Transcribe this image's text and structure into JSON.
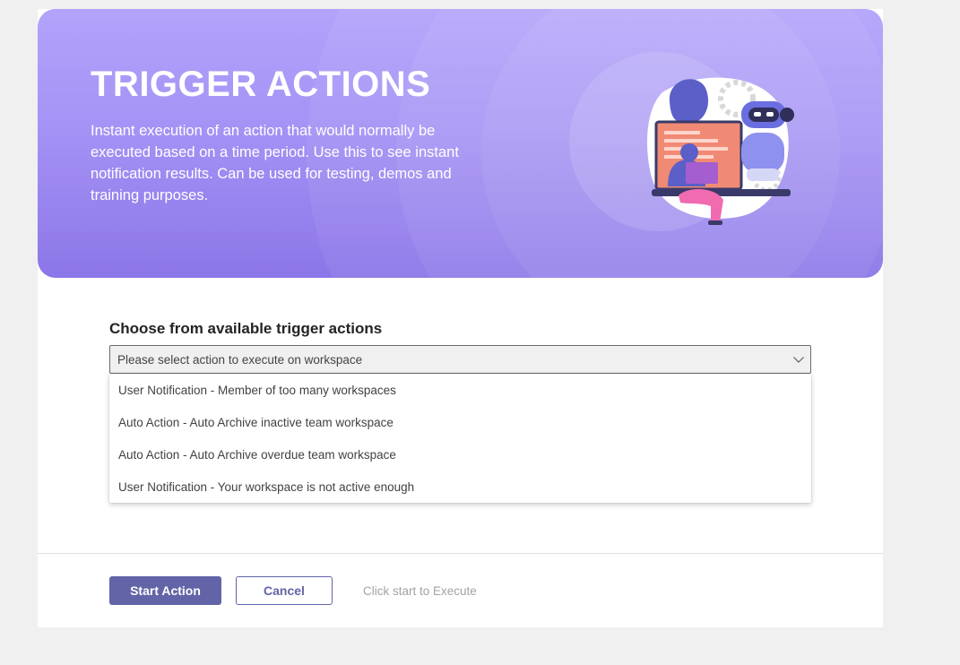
{
  "hero": {
    "title": "TRIGGER ACTIONS",
    "description": "Instant execution of an action that would normally be executed based on a time period. Use this to see instant notification results. Can be used for testing, demos and training purposes."
  },
  "form": {
    "label": "Choose from available trigger actions",
    "select_placeholder": "Please select action to execute on workspace",
    "options": [
      "User Notification - Member of too many workspaces",
      "Auto Action - Auto Archive inactive team workspace",
      "Auto Action - Auto Archive overdue team workspace",
      "User Notification - Your workspace is not active enough"
    ]
  },
  "footer": {
    "start_label": "Start Action",
    "cancel_label": "Cancel",
    "hint": "Click start to Execute"
  },
  "colors": {
    "accent": "#6264a7",
    "hero_top": "#b3a3fb",
    "hero_bottom": "#8c76e8",
    "page_bg": "#f0f0f0"
  },
  "icons": {
    "select_chevron": "chevron-down-icon",
    "hero_art": "robot-illustration"
  }
}
